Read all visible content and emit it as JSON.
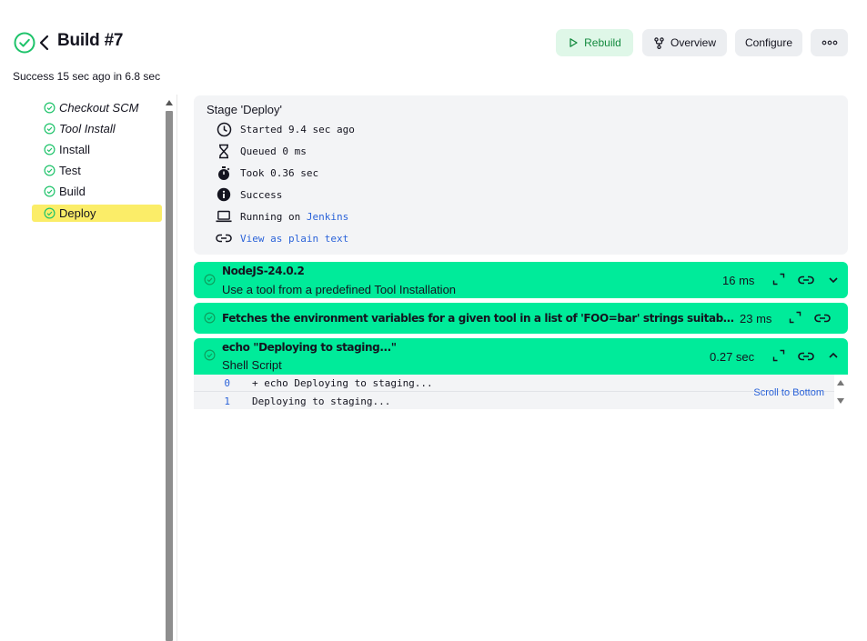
{
  "header": {
    "title": "Build #7",
    "subtitle": "Success 15 sec ago in 6.8 sec",
    "buttons": {
      "rebuild": "Rebuild",
      "overview": "Overview",
      "configure": "Configure"
    }
  },
  "colors": {
    "success": "#1ec36a",
    "step_bg": "#00eb9a",
    "selected_bg": "#fbed68",
    "link": "#2b63d9"
  },
  "tree": {
    "items": [
      {
        "label": "Checkout SCM",
        "italic": true,
        "selected": false
      },
      {
        "label": "Tool Install",
        "italic": true,
        "selected": false
      },
      {
        "label": "Install",
        "italic": false,
        "selected": false
      },
      {
        "label": "Test",
        "italic": false,
        "selected": false
      },
      {
        "label": "Build",
        "italic": false,
        "selected": false
      },
      {
        "label": "Deploy",
        "italic": false,
        "selected": true
      }
    ]
  },
  "stage": {
    "title": "Stage 'Deploy'",
    "started": "Started 9.4 sec ago",
    "queued": "Queued 0 ms",
    "took": "Took 0.36 sec",
    "status": "Success",
    "running_prefix": "Running on ",
    "running_node": "Jenkins",
    "plain_text_link": "View as plain text"
  },
  "steps": [
    {
      "title": "NodeJS-24.0.2",
      "subtitle": "Use a tool from a predefined Tool Installation",
      "duration": "16 ms",
      "expanded": false
    },
    {
      "title": "Fetches the environment variables for a given tool in a list of 'FOO=bar' strings suitable for the withEnv step.",
      "subtitle": "",
      "duration": "23 ms",
      "expanded": false
    },
    {
      "title": "echo \"Deploying to staging...\"",
      "subtitle": "Shell Script",
      "duration": "0.27 sec",
      "expanded": true
    }
  ],
  "log": {
    "lines": [
      {
        "num": "0",
        "text": "+ echo Deploying to staging..."
      },
      {
        "num": "1",
        "text": "Deploying to staging..."
      }
    ],
    "scroll_to_bottom": "Scroll to Bottom"
  }
}
